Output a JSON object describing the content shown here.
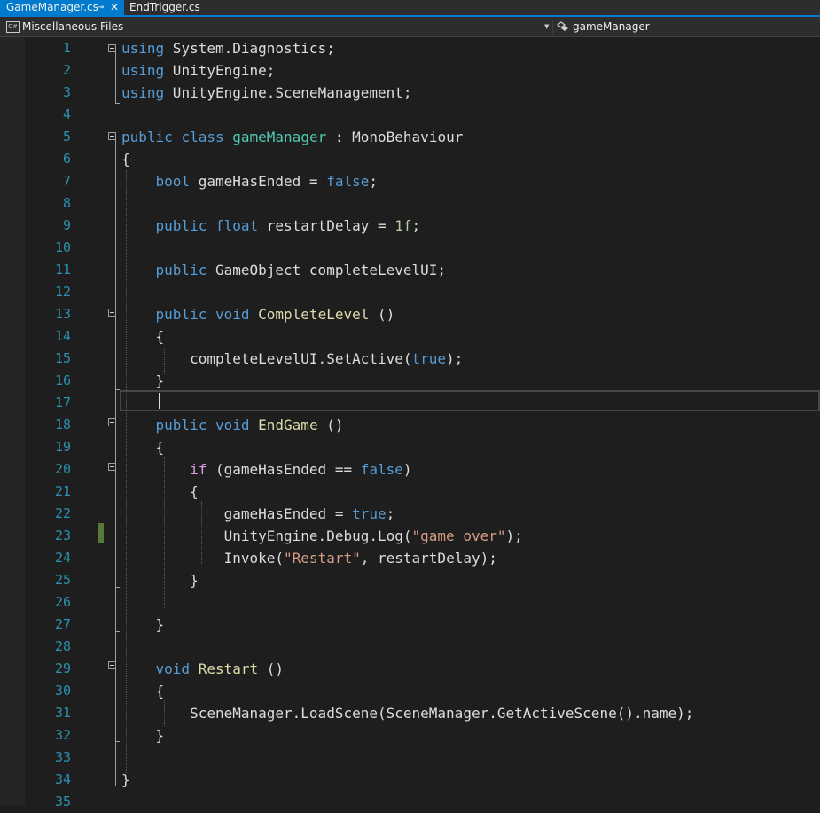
{
  "tabs": {
    "active_file": "GameManager.cs",
    "pin_glyph": "⊸",
    "close_glyph": "✕",
    "other_file": "EndTrigger.cs"
  },
  "navbar": {
    "project_icon": "C#",
    "project": "Miscellaneous Files",
    "dropdown_glyph": "▼",
    "member_icon": "class-member-icon",
    "member": "gameManager"
  },
  "colors": {
    "background": "#1e1e1e",
    "tab_active": "#007acc",
    "line_number": "#2b91af",
    "keyword": "#569cd6",
    "control_keyword": "#d8a0df",
    "type": "#4ec9b0",
    "method": "#dcdcaa",
    "string": "#d69d85",
    "number": "#b5cea8",
    "plain": "#dcdcdc"
  },
  "editor": {
    "line_numbers": [
      "1",
      "2",
      "3",
      "4",
      "5",
      "6",
      "7",
      "8",
      "9",
      "10",
      "11",
      "12",
      "13",
      "14",
      "15",
      "16",
      "17",
      "18",
      "19",
      "20",
      "21",
      "22",
      "23",
      "24",
      "25",
      "26",
      "27",
      "28",
      "29",
      "30",
      "31",
      "32",
      "33",
      "34",
      "35"
    ],
    "lines": [
      [
        [
          "kw",
          "using"
        ],
        [
          "plain",
          " System.Diagnostics;"
        ]
      ],
      [
        [
          "kw",
          "using"
        ],
        [
          "plain",
          " UnityEngine;"
        ]
      ],
      [
        [
          "kw",
          "using"
        ],
        [
          "plain",
          " UnityEngine.SceneManagement;"
        ]
      ],
      [],
      [
        [
          "kw",
          "public"
        ],
        [
          "plain",
          " "
        ],
        [
          "kw",
          "class"
        ],
        [
          "plain",
          " "
        ],
        [
          "type",
          "gameManager"
        ],
        [
          "plain",
          " : MonoBehaviour"
        ]
      ],
      [
        [
          "plain",
          "{"
        ]
      ],
      [
        [
          "plain",
          "    "
        ],
        [
          "kw",
          "bool"
        ],
        [
          "plain",
          " gameHasEnded = "
        ],
        [
          "kw",
          "false"
        ],
        [
          "plain",
          ";"
        ]
      ],
      [],
      [
        [
          "plain",
          "    "
        ],
        [
          "kw",
          "public"
        ],
        [
          "plain",
          " "
        ],
        [
          "kw",
          "float"
        ],
        [
          "plain",
          " restartDelay = "
        ],
        [
          "num",
          "1f"
        ],
        [
          "plain",
          ";"
        ]
      ],
      [],
      [
        [
          "plain",
          "    "
        ],
        [
          "kw",
          "public"
        ],
        [
          "plain",
          " GameObject completeLevelUI;"
        ]
      ],
      [],
      [
        [
          "plain",
          "    "
        ],
        [
          "kw",
          "public"
        ],
        [
          "plain",
          " "
        ],
        [
          "kw",
          "void"
        ],
        [
          "plain",
          " "
        ],
        [
          "method",
          "CompleteLevel"
        ],
        [
          "plain",
          " ()"
        ]
      ],
      [
        [
          "plain",
          "    {"
        ]
      ],
      [
        [
          "plain",
          "        completeLevelUI.SetActive("
        ],
        [
          "kw",
          "true"
        ],
        [
          "plain",
          ");"
        ]
      ],
      [
        [
          "plain",
          "    }"
        ]
      ],
      [],
      [
        [
          "plain",
          "    "
        ],
        [
          "kw",
          "public"
        ],
        [
          "plain",
          " "
        ],
        [
          "kw",
          "void"
        ],
        [
          "plain",
          " "
        ],
        [
          "method",
          "EndGame"
        ],
        [
          "plain",
          " ()"
        ]
      ],
      [
        [
          "plain",
          "    {"
        ]
      ],
      [
        [
          "plain",
          "        "
        ],
        [
          "ctl",
          "if"
        ],
        [
          "plain",
          " (gameHasEnded == "
        ],
        [
          "kw",
          "false"
        ],
        [
          "plain",
          ")"
        ]
      ],
      [
        [
          "plain",
          "        {"
        ]
      ],
      [
        [
          "plain",
          "            gameHasEnded = "
        ],
        [
          "kw",
          "true"
        ],
        [
          "plain",
          ";"
        ]
      ],
      [
        [
          "plain",
          "            UnityEngine.Debug.Log("
        ],
        [
          "str",
          "\"game over\""
        ],
        [
          "plain",
          ");"
        ]
      ],
      [
        [
          "plain",
          "            Invoke("
        ],
        [
          "str",
          "\"Restart\""
        ],
        [
          "plain",
          ", restartDelay);"
        ]
      ],
      [
        [
          "plain",
          "        }"
        ]
      ],
      [],
      [
        [
          "plain",
          "    }"
        ]
      ],
      [],
      [
        [
          "plain",
          "    "
        ],
        [
          "kw",
          "void"
        ],
        [
          "plain",
          " "
        ],
        [
          "method",
          "Restart"
        ],
        [
          "plain",
          " ()"
        ]
      ],
      [
        [
          "plain",
          "    {"
        ]
      ],
      [
        [
          "plain",
          "        SceneManager.LoadScene(SceneManager.GetActiveScene().name);"
        ]
      ],
      [
        [
          "plain",
          "    }"
        ]
      ],
      [],
      [
        [
          "plain",
          "}"
        ]
      ],
      []
    ]
  }
}
